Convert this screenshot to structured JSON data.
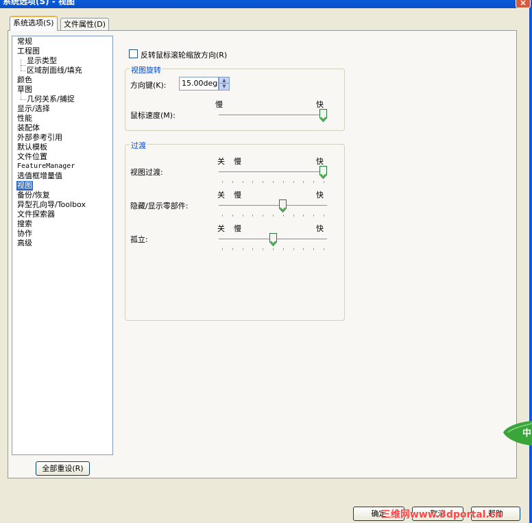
{
  "window": {
    "title": "系统选项(S) - 视图",
    "close_label": "×"
  },
  "tabs": [
    {
      "label": "系统选项(S)"
    },
    {
      "label": "文件属性(D)"
    }
  ],
  "tree": {
    "items": [
      {
        "label": "常规"
      },
      {
        "label": "工程图"
      },
      {
        "label": "显示类型"
      },
      {
        "label": "区域剖面线/填充"
      },
      {
        "label": "颜色"
      },
      {
        "label": "草图"
      },
      {
        "label": "几何关系/捕捉"
      },
      {
        "label": "显示/选择"
      },
      {
        "label": "性能"
      },
      {
        "label": "装配体"
      },
      {
        "label": "外部参考引用"
      },
      {
        "label": "默认模板"
      },
      {
        "label": "文件位置"
      },
      {
        "label": "FeatureManager"
      },
      {
        "label": "选值框增量值"
      },
      {
        "label": "视图"
      },
      {
        "label": "备份/恢复"
      },
      {
        "label": "异型孔向导/Toolbox"
      },
      {
        "label": "文件探索器"
      },
      {
        "label": "搜索"
      },
      {
        "label": "协作"
      },
      {
        "label": "高级"
      }
    ],
    "selected": "视图"
  },
  "reset_button": "全部重设(R)",
  "reverse_wheel": {
    "label": "反转鼠标滚轮缩放方向(R)",
    "checked": false
  },
  "view_rotation": {
    "title": "视图旋转",
    "arrow_keys_label": "方向键(K):",
    "arrow_keys_value": "15.00deg",
    "mouse_speed_label": "鼠标速度(M):",
    "slow": "慢",
    "fast": "快",
    "mouse_speed_level": 1.0
  },
  "transitions": {
    "title": "过渡",
    "off": "关",
    "slow": "慢",
    "fast": "快",
    "sliders": [
      {
        "label": "视图过渡:",
        "level": 1.0
      },
      {
        "label": "隐藏/显示零部件:",
        "level": 0.6
      },
      {
        "label": "孤立:",
        "level": 0.5
      }
    ]
  },
  "bottom_buttons": {
    "ok": "确定",
    "cancel": "取消",
    "help": "帮助"
  },
  "watermark": "三维网www.3dportal.cn",
  "leaf_text": "中",
  "colors": {
    "accent": "#316ac5",
    "group_title": "#0046d5",
    "watermark": "#ff4444"
  }
}
